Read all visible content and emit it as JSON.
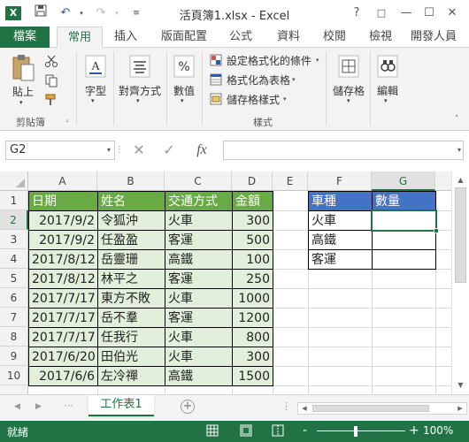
{
  "titlebar": {
    "logo": "X",
    "title": "活頁簿1.xlsx - Excel",
    "help": "?",
    "restore": "□",
    "minimize": "—",
    "maximize": "☐"
  },
  "tabs": {
    "file": "檔案",
    "items": [
      "常用",
      "插入",
      "版面配置",
      "公式",
      "資料",
      "校閱",
      "檢視",
      "開發人員"
    ],
    "active": "常用"
  },
  "ribbon": {
    "clipboard": {
      "paste": "貼上",
      "group": "剪貼簿"
    },
    "font": {
      "label": "字型"
    },
    "alignment": {
      "label": "對齊方式"
    },
    "number": {
      "label": "數值"
    },
    "styles": {
      "conditional": "設定格式化的條件",
      "table": "格式化為表格",
      "cell_styles": "儲存格樣式",
      "group": "樣式"
    },
    "cells": {
      "label": "儲存格"
    },
    "editing": {
      "label": "編輯"
    }
  },
  "formula_bar": {
    "name_box": "G2",
    "cancel": "✕",
    "enter": "✓",
    "fx": "fx",
    "value": ""
  },
  "grid": {
    "columns": [
      "A",
      "B",
      "C",
      "D",
      "E",
      "F",
      "G"
    ],
    "selected_column": "G",
    "rows": [
      "1",
      "2",
      "3",
      "4",
      "5",
      "6",
      "7",
      "8",
      "9",
      "10"
    ],
    "selected_row": "2",
    "table1": {
      "headers": [
        "日期",
        "姓名",
        "交通方式",
        "金額"
      ],
      "rows": [
        [
          "2017/9/2",
          "令狐沖",
          "火車",
          "300"
        ],
        [
          "2017/9/2",
          "任盈盈",
          "客運",
          "500"
        ],
        [
          "2017/8/12",
          "岳靈珊",
          "高鐵",
          "100"
        ],
        [
          "2017/8/12",
          "林平之",
          "客運",
          "250"
        ],
        [
          "2017/7/17",
          "東方不敗",
          "火車",
          "1000"
        ],
        [
          "2017/7/17",
          "岳不羣",
          "客運",
          "1200"
        ],
        [
          "2017/7/17",
          "任我行",
          "火車",
          "800"
        ],
        [
          "2017/6/20",
          "田伯光",
          "火車",
          "300"
        ],
        [
          "2017/6/6",
          "左冷禪",
          "高鐵",
          "1500"
        ]
      ]
    },
    "table2": {
      "headers": [
        "車種",
        "數量"
      ],
      "rows": [
        [
          "火車",
          ""
        ],
        [
          "高鐵",
          ""
        ],
        [
          "客運",
          ""
        ]
      ]
    }
  },
  "sheets": {
    "tabs": [
      "工作表1"
    ],
    "active": "工作表1",
    "add": "+",
    "more": "⋮"
  },
  "status": {
    "ready": "就緒",
    "zoom": "100%",
    "zoom_out": "-",
    "zoom_in": "+"
  },
  "colors": {
    "excel_green": "#217346",
    "header_green": "#6aaa45",
    "body_green": "#e2efda",
    "header_blue": "#4472c4"
  }
}
